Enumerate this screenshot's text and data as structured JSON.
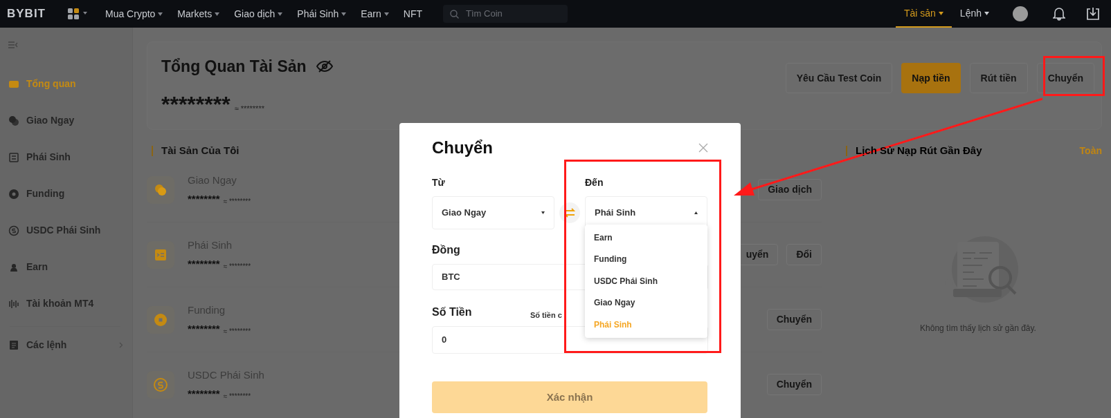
{
  "nav": {
    "logo": "BYBIT",
    "menu": [
      {
        "label": "Mua Crypto",
        "caret": true
      },
      {
        "label": "Markets",
        "caret": true
      },
      {
        "label": "Giao dịch",
        "caret": true
      },
      {
        "label": "Phái Sinh",
        "caret": true
      },
      {
        "label": "Earn",
        "caret": true
      },
      {
        "label": "NFT",
        "caret": false
      }
    ],
    "search": {
      "placeholder": "Tìm Coin"
    },
    "right": [
      {
        "label": "Tài sản",
        "selected": true
      },
      {
        "label": "Lệnh",
        "selected": false
      }
    ]
  },
  "sidebar": {
    "items": [
      {
        "label": "Tổng quan",
        "selected": true,
        "kind": "link"
      },
      {
        "label": "Giao Ngay",
        "selected": false,
        "kind": "link"
      },
      {
        "label": "Phái Sinh",
        "selected": false,
        "kind": "link"
      },
      {
        "label": "Funding",
        "selected": false,
        "kind": "link"
      },
      {
        "label": "USDC Phái Sinh",
        "selected": false,
        "kind": "link"
      },
      {
        "label": "Earn",
        "selected": false,
        "kind": "link"
      },
      {
        "label": "Tài khoản MT4",
        "selected": false,
        "kind": "link"
      },
      {
        "label": "Các lệnh",
        "selected": false,
        "kind": "group"
      }
    ]
  },
  "overview": {
    "title": "Tổng Quan Tài Sản",
    "balance": "********",
    "approx": "≈ ********",
    "buttons": [
      {
        "label": "Yêu Cầu Test Coin",
        "primary": false
      },
      {
        "label": "Nạp tiền",
        "primary": true
      },
      {
        "label": "Rút tiền",
        "primary": false
      },
      {
        "label": "Chuyển",
        "primary": false
      }
    ]
  },
  "my_assets": {
    "title": "Tài Sản Của Tôi",
    "accounts": [
      {
        "name": "Giao Ngay",
        "balance": "********",
        "approx": "≈ ********",
        "buttons": [
          "Giao dịch"
        ]
      },
      {
        "name": "Phái Sinh",
        "balance": "********",
        "approx": "≈ ********",
        "buttons": [
          "uyển",
          "Đổi"
        ]
      },
      {
        "name": "Funding",
        "balance": "********",
        "approx": "≈ ********",
        "buttons": [
          "Chuyển"
        ]
      },
      {
        "name": "USDC Phái Sinh",
        "balance": "********",
        "approx": "≈ ********",
        "buttons": [
          "Chuyển"
        ]
      }
    ]
  },
  "history": {
    "title": "Lịch Sử Nạp Rút Gần Đây",
    "link": "Toàn",
    "empty": "Không tìm thấy lịch sử gần đây."
  },
  "dialog": {
    "title": "Chuyển",
    "from": {
      "label": "Từ",
      "value": "Giao Ngay"
    },
    "to": {
      "label": "Đến",
      "value": "Phái Sinh",
      "expanded": true
    },
    "coin": {
      "label": "Đồng",
      "value": "BTC"
    },
    "amount": {
      "label": "Số Tiền",
      "available_label": "Số tiền c",
      "value": "0"
    },
    "options": [
      {
        "label": "Earn",
        "selected": false
      },
      {
        "label": "Funding",
        "selected": false
      },
      {
        "label": "USDC Phái Sinh",
        "selected": false
      },
      {
        "label": "Giao Ngay",
        "selected": false
      },
      {
        "label": "Phái Sinh",
        "selected": true
      }
    ],
    "confirm": "Xác nhận"
  }
}
